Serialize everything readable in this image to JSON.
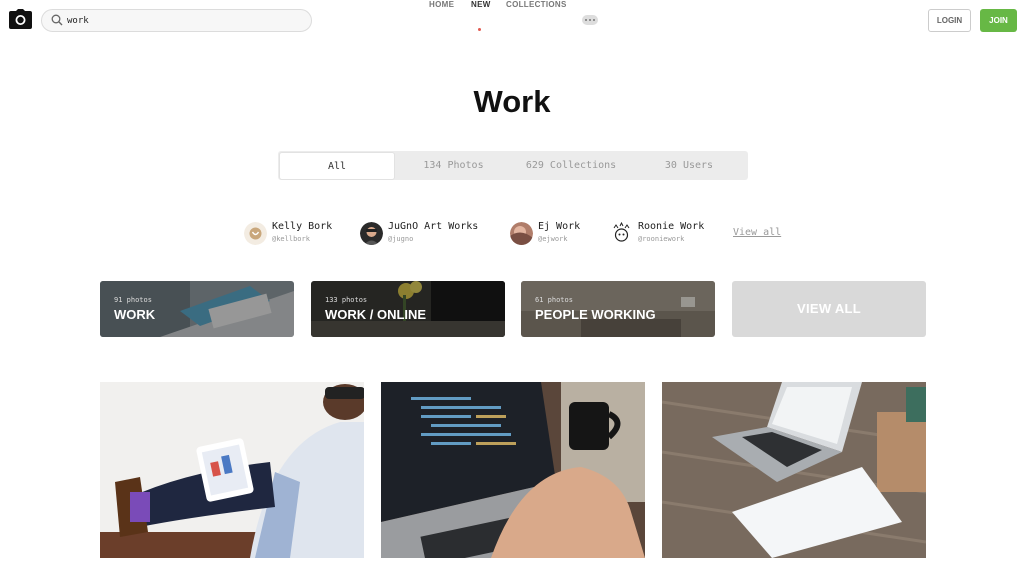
{
  "header": {
    "search": {
      "value": "work",
      "icon": "search-icon"
    },
    "nav": [
      {
        "label": "HOME"
      },
      {
        "label": "NEW"
      },
      {
        "label": "COLLECTIONS"
      }
    ],
    "login_label": "LOGIN",
    "join_label": "JOIN"
  },
  "page": {
    "title": "Work"
  },
  "tabs": [
    {
      "label": "All",
      "active": true
    },
    {
      "label": "134 Photos"
    },
    {
      "label": "629 Collections"
    },
    {
      "label": "30 Users"
    }
  ],
  "users": [
    {
      "name": "Kelly Bork",
      "handle": "@kellbork"
    },
    {
      "name": "JuGnO Art Works",
      "handle": "@jugno"
    },
    {
      "name": "Ej Work",
      "handle": "@ejwork"
    },
    {
      "name": "Roonie Work",
      "handle": "@rooniework"
    }
  ],
  "users_view_all": "View all",
  "collections": [
    {
      "count": "91 photos",
      "name": "WORK"
    },
    {
      "count": "133 photos",
      "name": "WORK / ONLINE"
    },
    {
      "count": "61 photos",
      "name": "PEOPLE WORKING"
    }
  ],
  "collections_view_all": "VIEW ALL",
  "colors": {
    "join": "#67b845",
    "active_dot": "#e25950"
  }
}
